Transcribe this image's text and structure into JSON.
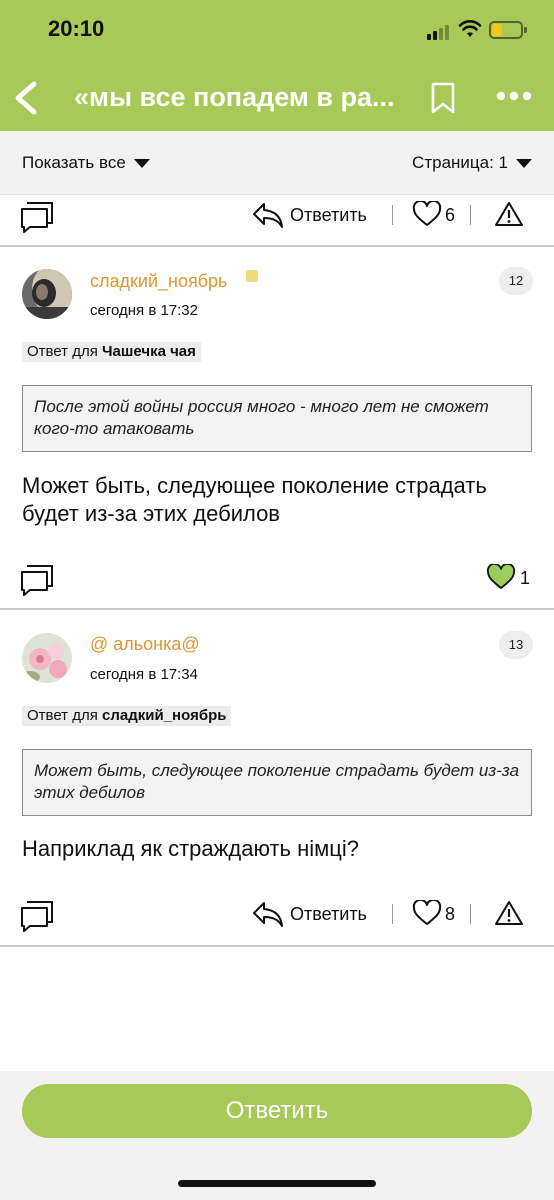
{
  "status_bar": {
    "time": "20:10"
  },
  "header": {
    "title": "«мы все попадем в ра...",
    "back_icon": "chevron-left-icon",
    "bookmark_icon": "bookmark-icon",
    "more_icon": "more-dots-icon"
  },
  "filters": {
    "show_label": "Показать все",
    "page_label": "Страница: 1"
  },
  "top_actions": {
    "reply_label": "Ответить",
    "likes": "6"
  },
  "posts": [
    {
      "username": "сладкий_ноябрь",
      "time": "сегодня в 17:32",
      "number": "12",
      "reply_prefix": "Ответ для ",
      "reply_to": "Чашечка чая",
      "quote": "После этой войны россия много - много лет не сможет кого-то атаковать",
      "text": "Может быть, следующее поколение страдать будет из-за этих дебилов",
      "likes": "1",
      "liked": true
    },
    {
      "username": "@ альонка@",
      "time": "сегодня в 17:34",
      "number": "13",
      "reply_prefix": "Ответ для ",
      "reply_to": "сладкий_ноябрь",
      "quote": "Может быть, следующее поколение страдать будет из-за этих дебилов",
      "text": "Наприклад як страждають німці?",
      "reply_label": "Ответить",
      "likes": "8",
      "liked": false
    }
  ],
  "footer": {
    "reply_button": "Ответить"
  },
  "colors": {
    "brand_green": "#a6c957",
    "username_orange": "#e0962e",
    "liked_heart": "#9ccc5a"
  }
}
